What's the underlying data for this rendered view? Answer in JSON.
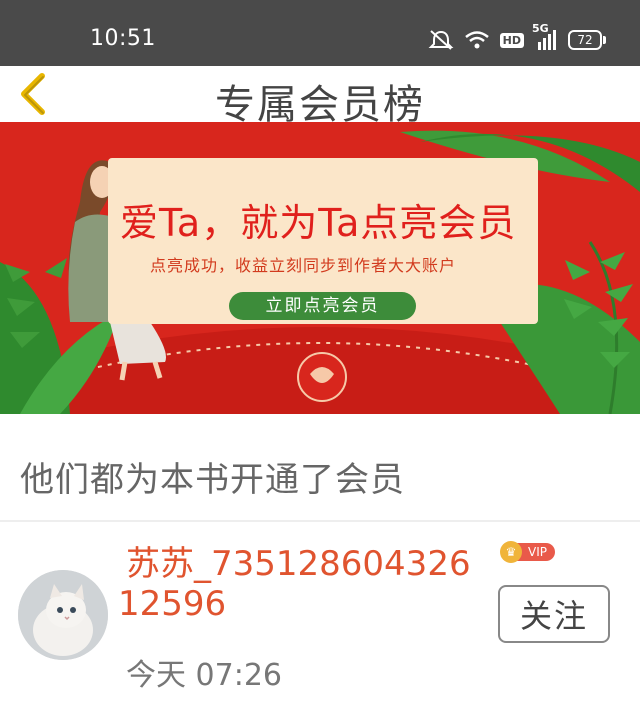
{
  "status_bar": {
    "time": "10:51",
    "hd_label": "HD",
    "network_label": "5G",
    "battery_level": "72"
  },
  "nav": {
    "title": "专属会员榜"
  },
  "banner": {
    "headline": "爱Ta，就为Ta点亮会员",
    "subtext": "点亮成功，收益立刻同步到作者大大账户",
    "button_label": "立即点亮会员"
  },
  "section": {
    "title": "他们都为本书开通了会员"
  },
  "members": [
    {
      "name_line1": "苏苏_735128604326",
      "name_line2": "12596",
      "badge": "VIP",
      "time": "今天 07:26",
      "follow_label": "关注"
    }
  ],
  "colors": {
    "status_bar": "#4a4a4a",
    "banner_red": "#d8261d",
    "name_orange": "#e0542f",
    "cta_green": "#3d8c3a"
  }
}
